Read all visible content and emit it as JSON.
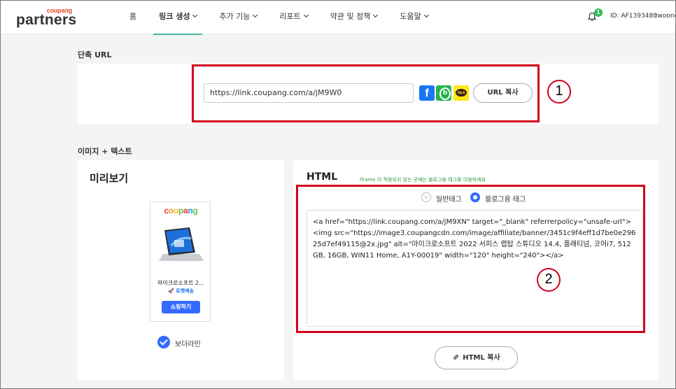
{
  "brand": {
    "small": "coupang",
    "big": "partners"
  },
  "nav": {
    "items": [
      {
        "label": "홈",
        "dropdown": false,
        "active": false
      },
      {
        "label": "링크 생성",
        "dropdown": true,
        "active": true
      },
      {
        "label": "추가 기능",
        "dropdown": true,
        "active": false
      },
      {
        "label": "리포트",
        "dropdown": true,
        "active": false
      },
      {
        "label": "약관 및 정책",
        "dropdown": true,
        "active": false
      },
      {
        "label": "도움말",
        "dropdown": true,
        "active": false
      }
    ],
    "notification_count": "1",
    "user_id": "ID: AF1393480",
    "user_name": "twoone"
  },
  "short_url": {
    "section_title": "단축 URL",
    "url": "https://link.coupang.com/a/jM9W0",
    "copy_label": "URL 복사"
  },
  "image_text": {
    "section_title": "이미지 + 텍스트",
    "preview": {
      "title": "미리보기",
      "banner_name": "마이크로소프트 2...",
      "rocket_label": "🚀 로켓배송",
      "shop_button": "쇼핑하기",
      "border_label": "보더라인"
    },
    "html": {
      "title": "HTML",
      "notice": "iframe 이 적용되지 않는 곳에는 블로그용 태그를 이용하세요",
      "radio_normal": "일반태그",
      "radio_blog": "블로그용 태그",
      "code": "<a href=\"https://link.coupang.com/a/jM9XN\" target=\"_blank\" referrerpolicy=\"unsafe-url\"><img src=\"https://image3.coupangcdn.com/image/affiliate/banner/3451c9f4eff1d7be0e29625d7ef49115@2x.jpg\" alt=\"마이크로소프트 2022 서피스 랩탑 스튜디오 14.4, 플래티넘, 코어i7, 512GB, 16GB, WIN11 Home, A1Y-00019\" width=\"120\" height=\"240\"></a>",
      "copy_label": "HTML 복사"
    }
  },
  "annotations": {
    "one": "1",
    "two": "2"
  },
  "colors": {
    "accent": "#346aff",
    "annotation": "#d0021b",
    "active_underline": "#3fb6a0"
  }
}
